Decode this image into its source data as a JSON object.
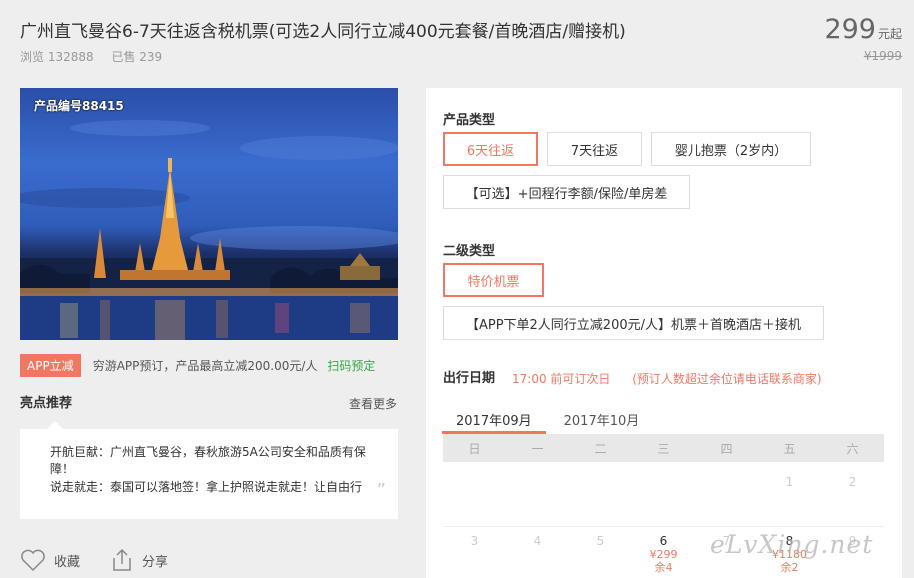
{
  "title": "广州直飞曼谷6-7天往返含税机票(可选2人同行立减400元套餐/首晚酒店/赠接机)",
  "stats": {
    "views": "浏览 132888",
    "sold": "已售 239"
  },
  "price": {
    "value": "299",
    "unit": "元起",
    "original": "¥1999"
  },
  "hero": {
    "code": "产品编号88415"
  },
  "app": {
    "badge": "APP立减",
    "text": "穷游APP预订，产品最高立减200.00元/人",
    "scan": "扫码预定"
  },
  "highlights": {
    "title": "亮点推荐",
    "more": "查看更多",
    "lines": [
      "开航巨献：广州直飞曼谷，春秋旅游5A公司安全和品质有保障！",
      "说走就走：泰国可以落地签！拿上护照说走就走！让自由行"
    ],
    "quote": "”"
  },
  "actions": {
    "favorite": "收藏",
    "share": "分享"
  },
  "product_type": {
    "label": "产品类型",
    "options": [
      "6天往返",
      "7天往返",
      "婴儿抱票（2岁内）",
      "【可选】+回程行李额/保险/单房差"
    ],
    "selected": "6天往返"
  },
  "sub_type": {
    "label": "二级类型",
    "options": [
      "特价机票",
      "【APP下单2人同行立减200元/人】机票＋首晚酒店＋接机"
    ],
    "selected": "特价机票"
  },
  "travel_date": {
    "label": "出行日期",
    "note1": "17:00 前可订次日",
    "note2": "(预订人数超过余位请电话联系商家)"
  },
  "calendar": {
    "months": [
      "2017年09月",
      "2017年10月"
    ],
    "active_month": "2017年09月",
    "weekdays": [
      "日",
      "一",
      "二",
      "三",
      "四",
      "五",
      "六"
    ],
    "row1": [
      "",
      "",
      "",
      "",
      "",
      "1",
      "2"
    ],
    "row2": [
      {
        "day": "3"
      },
      {
        "day": "4"
      },
      {
        "day": "5"
      },
      {
        "day": "6",
        "price": "¥299",
        "left": "余4"
      },
      {
        "day": "7"
      },
      {
        "day": "8",
        "price": "¥1180",
        "left": "余2"
      },
      {
        "day": "9"
      }
    ]
  },
  "watermark": "eLvXing.net"
}
